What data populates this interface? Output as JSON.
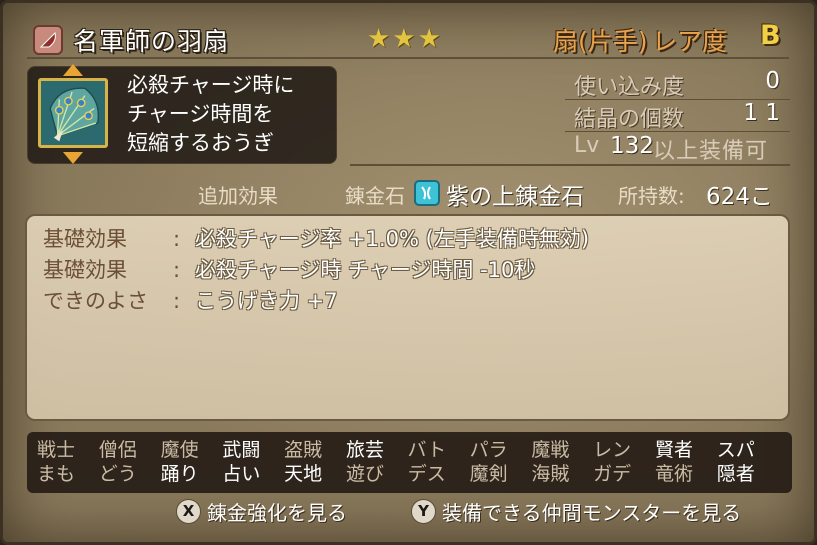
{
  "header": {
    "item_name": "名軍師の羽扇",
    "stars": "★★★",
    "weapon_type": "扇(片手)",
    "rarity_label": "レア度",
    "rarity_value": "B"
  },
  "description": {
    "lines": [
      "必殺チャージ時に",
      "チャージ時間を",
      "短縮するおうぎ"
    ]
  },
  "stats": {
    "usage_label": "使い込み度",
    "usage_value": "0",
    "crystal_label": "結晶の個数",
    "crystal_value": "1 1",
    "lv_prefix": "Lv",
    "lv_value": "132",
    "lv_suffix": "以上装備可"
  },
  "alchemy": {
    "extra_label": "追加効果",
    "stone_label": "錬金石",
    "stone_name": "紫の上錬金石",
    "owned_label": "所持数:",
    "owned_value": "624こ"
  },
  "effects": [
    {
      "label": "基礎効果",
      "sep": ":",
      "value": "必殺チャージ率 +1.0% (左手装備時無効)"
    },
    {
      "label": "基礎効果",
      "sep": ":",
      "value": "必殺チャージ時 チャージ時間 -10秒"
    },
    {
      "label": "できのよさ",
      "sep": ":",
      "value": "こうげき力 +7"
    }
  ],
  "jobs": {
    "row1": [
      {
        "label": "戦士",
        "on": false
      },
      {
        "label": "僧侶",
        "on": false
      },
      {
        "label": "魔使",
        "on": false
      },
      {
        "label": "武闘",
        "on": true
      },
      {
        "label": "盗賊",
        "on": false
      },
      {
        "label": "旅芸",
        "on": true
      },
      {
        "label": "バト",
        "on": false
      },
      {
        "label": "パラ",
        "on": false
      },
      {
        "label": "魔戦",
        "on": false
      },
      {
        "label": "レン",
        "on": false
      },
      {
        "label": "賢者",
        "on": true
      },
      {
        "label": "スパ",
        "on": true
      }
    ],
    "row2": [
      {
        "label": "まも",
        "on": false
      },
      {
        "label": "どう",
        "on": false
      },
      {
        "label": "踊り",
        "on": true
      },
      {
        "label": "占い",
        "on": true
      },
      {
        "label": "天地",
        "on": true
      },
      {
        "label": "遊び",
        "on": false
      },
      {
        "label": "デス",
        "on": false
      },
      {
        "label": "魔剣",
        "on": false
      },
      {
        "label": "海賊",
        "on": false
      },
      {
        "label": "ガデ",
        "on": false
      },
      {
        "label": "竜術",
        "on": false
      },
      {
        "label": "隠者",
        "on": true
      }
    ]
  },
  "footer": {
    "x_button": "X",
    "x_label": "錬金強化を見る",
    "y_button": "Y",
    "y_label": "装備できる仲間モンスターを見る"
  },
  "colors": {
    "accent_orange": "#e9a34a",
    "star_gold": "#e2c440",
    "alchemy_cyan": "#3ec3d6",
    "job_disabled": "#c9bba4",
    "job_enabled": "#ffffff"
  }
}
